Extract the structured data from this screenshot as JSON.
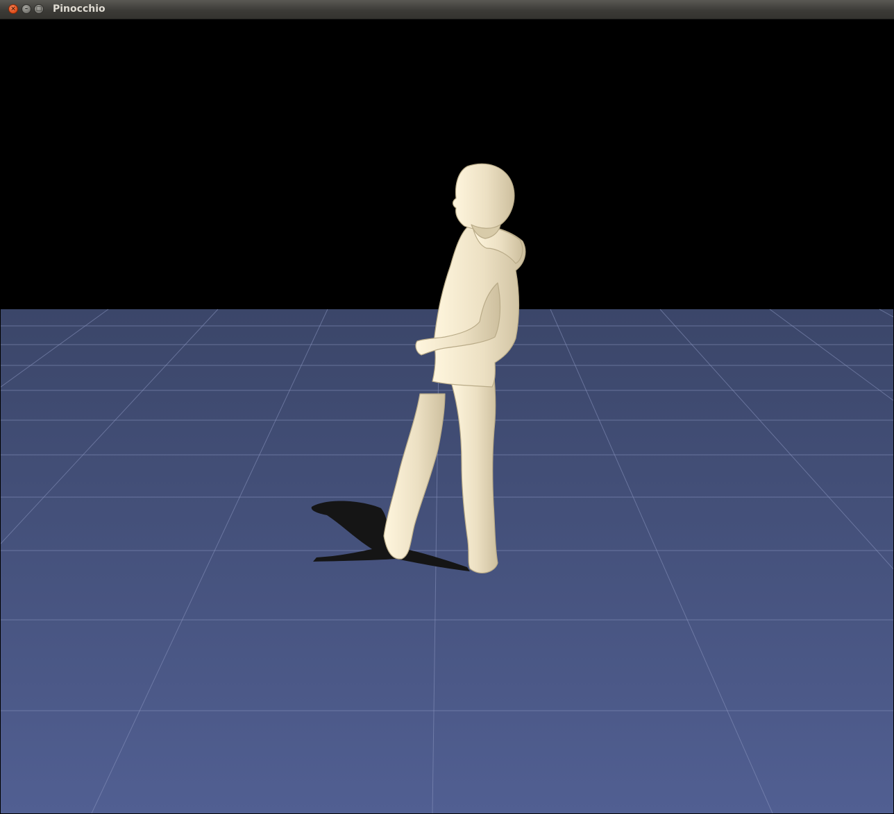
{
  "window": {
    "title": "Pinocchio",
    "buttons": {
      "close_icon": "close-icon",
      "minimize_icon": "minimize-icon",
      "maximize_icon": "maximize-icon"
    }
  },
  "scene": {
    "background_color": "#000000",
    "floor_color_near": "#515f92",
    "floor_color_far": "#3b4669",
    "grid_line_color": "#8a96c0",
    "model_color": "#ece0c3",
    "shadow_color": "#151515"
  }
}
